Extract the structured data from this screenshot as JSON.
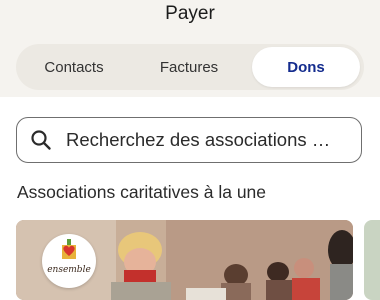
{
  "header": {
    "title": "Payer"
  },
  "tabs": [
    {
      "label": "Contacts",
      "selected": false
    },
    {
      "label": "Factures",
      "selected": false
    },
    {
      "label": "Dons",
      "selected": true
    }
  ],
  "search": {
    "placeholder": "Recherchez des associations o...",
    "icon": "search-icon"
  },
  "featured": {
    "title": "Associations caritatives à la une",
    "cards": [
      {
        "logo_text": "ensemble",
        "image": "volunteers-photo"
      }
    ]
  },
  "colors": {
    "accent": "#142c8e",
    "header_bg": "#f5f3ef"
  }
}
